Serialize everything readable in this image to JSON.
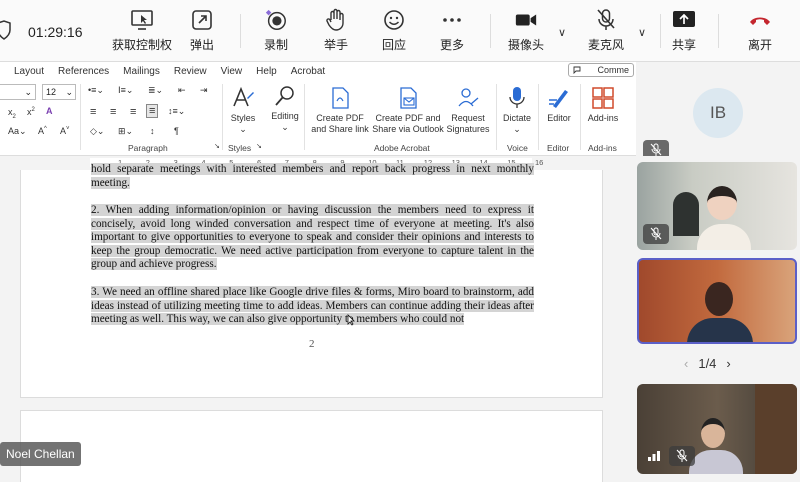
{
  "meeting_toolbar": {
    "timer": "01:29:16",
    "items": [
      {
        "label": "获取控制权",
        "icon": "screen-control-icon"
      },
      {
        "label": "弹出",
        "icon": "popout-icon"
      },
      {
        "label": "录制",
        "icon": "record-icon"
      },
      {
        "label": "举手",
        "icon": "raise-hand-icon"
      },
      {
        "label": "回应",
        "icon": "emoji-icon"
      },
      {
        "label": "更多",
        "icon": "more-icon"
      },
      {
        "label": "摄像头",
        "icon": "camera-icon"
      },
      {
        "label": "麦克风",
        "icon": "mic-off-icon"
      },
      {
        "label": "共享",
        "icon": "share-icon"
      },
      {
        "label": "离开",
        "icon": "leave-icon"
      }
    ],
    "leave_color": "#c4262e"
  },
  "word": {
    "menu": [
      "Layout",
      "References",
      "Mailings",
      "Review",
      "View",
      "Help",
      "Acrobat"
    ],
    "comments_label": "Comme",
    "font_size": "12",
    "groups": {
      "paragraph": "Paragraph",
      "styles": "Styles",
      "adobe": "Adobe Acrobat",
      "voice": "Voice",
      "editor": "Editor",
      "addins": "Add-ins"
    },
    "buttons": {
      "styles": "Styles",
      "editing": "Editing",
      "create_pdf": [
        "Create PDF",
        "and Share link"
      ],
      "create_pdf_outlook": [
        "Create PDF and",
        "Share via Outlook"
      ],
      "request_sig": [
        "Request",
        "Signatures"
      ],
      "dictate": "Dictate",
      "editor": "Editor",
      "addins": "Add-ins"
    },
    "ruler_marks": [
      "1",
      "2",
      "3",
      "4",
      "5",
      "6",
      "7",
      "8",
      "9",
      "10",
      "11",
      "12",
      "13",
      "14",
      "15",
      "16"
    ],
    "doc": {
      "p0": "hold separate meetings with interested members and report back progress in next monthly meeting.",
      "p1": "2. When adding information/opinion or having discussion the members need to express it concisely, avoid long winded conversation and respect time of everyone at meeting. It's also important to give opportunities to everyone to speak and consider their opinions and interests to keep the group democratic. We need active participation from everyone to capture talent in the group and achieve progress.",
      "p2": "3. We need an offline shared place like Google drive files & forms, Miro board to brainstorm, add ideas instead of utilizing meeting time to add ideas. Members can continue adding their ideas after meeting as well. This way, we can also give opportunity to members who could not",
      "page_number": "2"
    }
  },
  "participants": {
    "avatar_initials": "IB",
    "pager": "1/4",
    "active_speaker_border": "#5b5fc7",
    "name_tag": "Noel Chellan"
  }
}
